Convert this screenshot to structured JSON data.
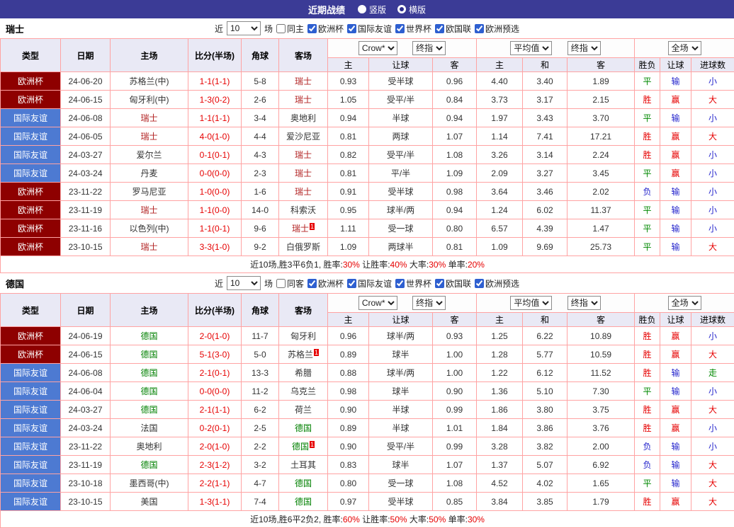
{
  "topbar": {
    "title": "近期战绩",
    "layout_options": [
      {
        "key": "vertical",
        "label": "竖版",
        "selected": false
      },
      {
        "key": "horizontal",
        "label": "横版",
        "selected": true
      }
    ]
  },
  "filter": {
    "near": "近",
    "count": "10",
    "games": "场",
    "competitions": [
      "欧洲杯",
      "国际友谊",
      "世界杯",
      "欧国联",
      "欧洲预选"
    ]
  },
  "selects": {
    "odds_source": "Crow*",
    "odds_final": "终指",
    "avg_source": "平均值",
    "avg_final": "终指",
    "scope": "全场"
  },
  "columns": {
    "type": "类型",
    "date": "日期",
    "home": "主场",
    "score": "比分(半场)",
    "corner": "角球",
    "away": "客场",
    "sub": [
      "主",
      "让球",
      "客",
      "主",
      "和",
      "客",
      "胜负",
      "让球",
      "进球数"
    ]
  },
  "colors": {
    "accent": "#3b3b96",
    "grid": "#ffa3a3",
    "score": "#e60000",
    "type_bg": {
      "欧洲杯": "#8e0000",
      "国际友谊": "#4d7ad2"
    },
    "team": {
      "瑞士": "#b22222",
      "德国": "#008000"
    },
    "result": {
      "胜": "#e60000",
      "平": "#008800",
      "负": "#2424cc",
      "赢": "#e60000",
      "输": "#2424cc",
      "大": "#e60000",
      "小": "#2424cc",
      "走": "#008800"
    }
  },
  "sections": [
    {
      "team": "瑞士",
      "same_label": "同主",
      "rows": [
        {
          "type": "欧洲杯",
          "date": "24-06-20",
          "home": "苏格兰(中)",
          "score": "1-1(1-1)",
          "corner": "5-8",
          "away": "瑞士",
          "h1": "0.93",
          "line": "受半球",
          "h2": "0.96",
          "e1": "4.40",
          "e2": "3.40",
          "e3": "1.89",
          "res": "平",
          "cover": "输",
          "goal": "小"
        },
        {
          "type": "欧洲杯",
          "date": "24-06-15",
          "home": "匈牙利(中)",
          "score": "1-3(0-2)",
          "corner": "2-6",
          "away": "瑞士",
          "h1": "1.05",
          "line": "受平/半",
          "h2": "0.84",
          "e1": "3.73",
          "e2": "3.17",
          "e3": "2.15",
          "res": "胜",
          "cover": "赢",
          "goal": "大"
        },
        {
          "type": "国际友谊",
          "date": "24-06-08",
          "home": "瑞士",
          "score": "1-1(1-1)",
          "corner": "3-4",
          "away": "奥地利",
          "h1": "0.94",
          "line": "半球",
          "h2": "0.94",
          "e1": "1.97",
          "e2": "3.43",
          "e3": "3.70",
          "res": "平",
          "cover": "输",
          "goal": "小"
        },
        {
          "type": "国际友谊",
          "date": "24-06-05",
          "home": "瑞士",
          "score": "4-0(1-0)",
          "corner": "4-4",
          "away": "爱沙尼亚",
          "h1": "0.81",
          "line": "两球",
          "h2": "1.07",
          "e1": "1.14",
          "e2": "7.41",
          "e3": "17.21",
          "res": "胜",
          "cover": "赢",
          "goal": "大"
        },
        {
          "type": "国际友谊",
          "date": "24-03-27",
          "home": "爱尔兰",
          "score": "0-1(0-1)",
          "corner": "4-3",
          "away": "瑞士",
          "h1": "0.82",
          "line": "受平/半",
          "h2": "1.08",
          "e1": "3.26",
          "e2": "3.14",
          "e3": "2.24",
          "res": "胜",
          "cover": "赢",
          "goal": "小"
        },
        {
          "type": "国际友谊",
          "date": "24-03-24",
          "home": "丹麦",
          "score": "0-0(0-0)",
          "corner": "2-3",
          "away": "瑞士",
          "h1": "0.81",
          "line": "平/半",
          "h2": "1.09",
          "e1": "2.09",
          "e2": "3.27",
          "e3": "3.45",
          "res": "平",
          "cover": "赢",
          "goal": "小"
        },
        {
          "type": "欧洲杯",
          "date": "23-11-22",
          "home": "罗马尼亚",
          "score": "1-0(0-0)",
          "corner": "1-6",
          "away": "瑞士",
          "h1": "0.91",
          "line": "受半球",
          "h2": "0.98",
          "e1": "3.64",
          "e2": "3.46",
          "e3": "2.02",
          "res": "负",
          "cover": "输",
          "goal": "小"
        },
        {
          "type": "欧洲杯",
          "date": "23-11-19",
          "home": "瑞士",
          "score": "1-1(0-0)",
          "corner": "14-0",
          "away": "科索沃",
          "h1": "0.95",
          "line": "球半/两",
          "h2": "0.94",
          "e1": "1.24",
          "e2": "6.02",
          "e3": "11.37",
          "res": "平",
          "cover": "输",
          "goal": "小"
        },
        {
          "type": "欧洲杯",
          "date": "23-11-16",
          "home": "以色列(中)",
          "score": "1-1(0-1)",
          "corner": "9-6",
          "away": "瑞士",
          "away_badge": "1",
          "h1": "1.11",
          "line": "受一球",
          "h2": "0.80",
          "e1": "6.57",
          "e2": "4.39",
          "e3": "1.47",
          "res": "平",
          "cover": "输",
          "goal": "小"
        },
        {
          "type": "欧洲杯",
          "date": "23-10-15",
          "home": "瑞士",
          "score": "3-3(1-0)",
          "corner": "9-2",
          "away": "白俄罗斯",
          "h1": "1.09",
          "line": "两球半",
          "h2": "0.81",
          "e1": "1.09",
          "e2": "9.69",
          "e3": "25.73",
          "res": "平",
          "cover": "输",
          "goal": "大"
        }
      ],
      "footer": [
        {
          "t": "近10场,胜3平6负1, 胜率:",
          "red": false
        },
        {
          "t": "30%",
          "red": true
        },
        {
          "t": " 让胜率:",
          "red": false
        },
        {
          "t": "40%",
          "red": true
        },
        {
          "t": " 大率:",
          "red": false
        },
        {
          "t": "30%",
          "red": true
        },
        {
          "t": " 单率:",
          "red": false
        },
        {
          "t": "20%",
          "red": true
        }
      ]
    },
    {
      "team": "德国",
      "same_label": "同客",
      "rows": [
        {
          "type": "欧洲杯",
          "date": "24-06-19",
          "home": "德国",
          "score": "2-0(1-0)",
          "corner": "11-7",
          "away": "匈牙利",
          "h1": "0.96",
          "line": "球半/两",
          "h2": "0.93",
          "e1": "1.25",
          "e2": "6.22",
          "e3": "10.89",
          "res": "胜",
          "cover": "赢",
          "goal": "小"
        },
        {
          "type": "欧洲杯",
          "date": "24-06-15",
          "home": "德国",
          "score": "5-1(3-0)",
          "corner": "5-0",
          "away": "苏格兰",
          "away_badge": "1",
          "h1": "0.89",
          "line": "球半",
          "h2": "1.00",
          "e1": "1.28",
          "e2": "5.77",
          "e3": "10.59",
          "res": "胜",
          "cover": "赢",
          "goal": "大"
        },
        {
          "type": "国际友谊",
          "date": "24-06-08",
          "home": "德国",
          "score": "2-1(0-1)",
          "corner": "13-3",
          "away": "希腊",
          "h1": "0.88",
          "line": "球半/两",
          "h2": "1.00",
          "e1": "1.22",
          "e2": "6.12",
          "e3": "11.52",
          "res": "胜",
          "cover": "输",
          "goal": "走"
        },
        {
          "type": "国际友谊",
          "date": "24-06-04",
          "home": "德国",
          "score": "0-0(0-0)",
          "corner": "11-2",
          "away": "乌克兰",
          "h1": "0.98",
          "line": "球半",
          "h2": "0.90",
          "e1": "1.36",
          "e2": "5.10",
          "e3": "7.30",
          "res": "平",
          "cover": "输",
          "goal": "小"
        },
        {
          "type": "国际友谊",
          "date": "24-03-27",
          "home": "德国",
          "score": "2-1(1-1)",
          "corner": "6-2",
          "away": "荷兰",
          "h1": "0.90",
          "line": "半球",
          "h2": "0.99",
          "e1": "1.86",
          "e2": "3.80",
          "e3": "3.75",
          "res": "胜",
          "cover": "赢",
          "goal": "大"
        },
        {
          "type": "国际友谊",
          "date": "24-03-24",
          "home": "法国",
          "score": "0-2(0-1)",
          "corner": "2-5",
          "away": "德国",
          "h1": "0.89",
          "line": "半球",
          "h2": "1.01",
          "e1": "1.84",
          "e2": "3.86",
          "e3": "3.76",
          "res": "胜",
          "cover": "赢",
          "goal": "小"
        },
        {
          "type": "国际友谊",
          "date": "23-11-22",
          "home": "奥地利",
          "score": "2-0(1-0)",
          "corner": "2-2",
          "away": "德国",
          "away_badge": "1",
          "h1": "0.90",
          "line": "受平/半",
          "h2": "0.99",
          "e1": "3.28",
          "e2": "3.82",
          "e3": "2.00",
          "res": "负",
          "cover": "输",
          "goal": "小"
        },
        {
          "type": "国际友谊",
          "date": "23-11-19",
          "home": "德国",
          "score": "2-3(1-2)",
          "corner": "3-2",
          "away": "土耳其",
          "h1": "0.83",
          "line": "球半",
          "h2": "1.07",
          "e1": "1.37",
          "e2": "5.07",
          "e3": "6.92",
          "res": "负",
          "cover": "输",
          "goal": "大"
        },
        {
          "type": "国际友谊",
          "date": "23-10-18",
          "home": "墨西哥(中)",
          "score": "2-2(1-1)",
          "corner": "4-7",
          "away": "德国",
          "h1": "0.80",
          "line": "受一球",
          "h2": "1.08",
          "e1": "4.52",
          "e2": "4.02",
          "e3": "1.65",
          "res": "平",
          "cover": "输",
          "goal": "大"
        },
        {
          "type": "国际友谊",
          "date": "23-10-15",
          "home": "美国",
          "score": "1-3(1-1)",
          "corner": "7-4",
          "away": "德国",
          "h1": "0.97",
          "line": "受半球",
          "h2": "0.85",
          "e1": "3.84",
          "e2": "3.85",
          "e3": "1.79",
          "res": "胜",
          "cover": "赢",
          "goal": "大"
        }
      ],
      "footer": [
        {
          "t": "近10场,胜6平2负2, 胜率:",
          "red": false
        },
        {
          "t": "60%",
          "red": true
        },
        {
          "t": " 让胜率:",
          "red": false
        },
        {
          "t": "50%",
          "red": true
        },
        {
          "t": " 大率:",
          "red": false
        },
        {
          "t": "50%",
          "red": true
        },
        {
          "t": " 单率:",
          "red": false
        },
        {
          "t": "30%",
          "red": true
        }
      ]
    }
  ]
}
